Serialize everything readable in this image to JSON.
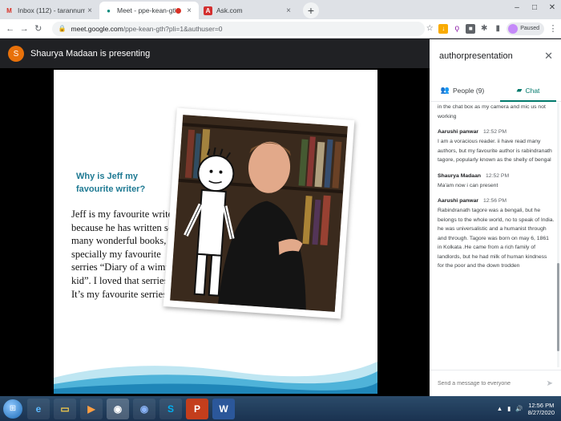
{
  "browser": {
    "tabs": [
      {
        "title": "Inbox (112) - tarannum@theindi",
        "favicon_color": "#d93025",
        "favicon_text": "M"
      },
      {
        "title": "Meet - ppe-kean-gth",
        "favicon_color": "#00897b",
        "favicon_text": "●"
      },
      {
        "title": "Ask.com",
        "favicon_color": "#d32f2f",
        "favicon_text": "A"
      }
    ],
    "new_tab_label": "+",
    "url_host": "meet.google.com",
    "url_path": "/ppe-kean-gth?pli=1&authuser=0",
    "profile_status": "Paused"
  },
  "meet": {
    "presenter_initial": "S",
    "presenter_text": "Shaurya Madaan is presenting",
    "slide": {
      "heading": "Why is Jeff my favourite writer?",
      "body": "Jeff is my favourite writer because he has written so many wonderful books, specially my favourite serries “Diary of a wimpy kid”. I loved that serries. It’s my favourite serries."
    }
  },
  "panel": {
    "title": "authorpresentation",
    "tab_people": "People (9)",
    "tab_chat": "Chat",
    "messages": [
      {
        "sender": "",
        "time": "",
        "text": "in the chat box as my camera and mic us not working"
      },
      {
        "sender": "Aarushi panwar",
        "time": "12:52 PM",
        "text": "I am a voracious  reader. ii have read many authors, but my favourite author is rabindranath tagore, popularly known as the shelly of bengal"
      },
      {
        "sender": "Shaurya Madaan",
        "time": "12:52 PM",
        "text": "Ma'am now i can present"
      },
      {
        "sender": "Aarushi panwar",
        "time": "12:56 PM",
        "text": "Rabindranath tagore was a bengali, but he belongs to the whole world, no to speak of India. he was universalistic and a humanist through and through. Tagore was born on may 6, 1861 in Kolkata .He came from a rich family of landlords, but he had milk of human kindness for the poor and the down trodden"
      }
    ],
    "compose_placeholder": "Send a message to everyone"
  },
  "taskbar": {
    "time": "12:56 PM",
    "date": "8/27/2020"
  },
  "colors": {
    "accent": "#00796b",
    "slide_heading": "#1f7a93",
    "presenter_avatar": "#e8710a"
  }
}
